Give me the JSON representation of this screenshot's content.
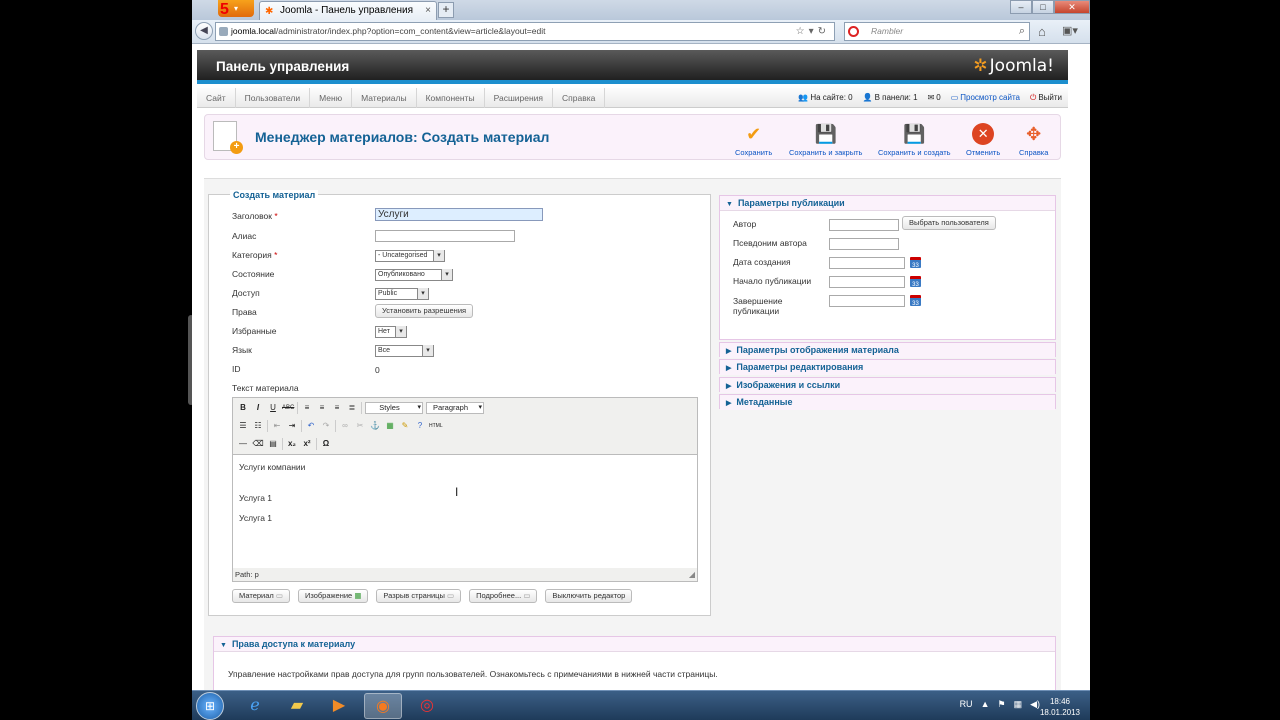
{
  "browser": {
    "tab_title": "Joomla - Панель управления",
    "url_host": "joomla.local",
    "url_path": "/administrator/index.php?option=com_content&view=article&layout=edit",
    "search_placeholder": "Rambler",
    "new_tab": "+",
    "tab_close": "×"
  },
  "header": {
    "title": "Панель управления",
    "logo_text": "Joomla!"
  },
  "menu": {
    "items": [
      "Сайт",
      "Пользователи",
      "Меню",
      "Материалы",
      "Компоненты",
      "Расширения",
      "Справка"
    ],
    "status_site": "На сайте: 0",
    "status_panel": "В панели: 1",
    "status_messages": "0",
    "view_site": "Просмотр сайта",
    "logout": "Выйти"
  },
  "toolbar": {
    "page_title": "Менеджер материалов: Создать материал",
    "save": "Сохранить",
    "save_close": "Сохранить и закрыть",
    "save_new": "Сохранить и создать",
    "cancel": "Отменить",
    "help": "Справка"
  },
  "form": {
    "legend": "Создать материал",
    "title_label": "Заголовок",
    "title_value": "Услуги",
    "alias_label": "Алиас",
    "alias_value": "",
    "category_label": "Категория",
    "category_value": "- Uncategorised",
    "state_label": "Состояние",
    "state_value": "Опубликовано",
    "access_label": "Доступ",
    "access_value": "Public",
    "permissions_label": "Права",
    "permissions_button": "Установить разрешения",
    "featured_label": "Избранные",
    "featured_value": "Нет",
    "language_label": "Язык",
    "language_value": "Все",
    "id_label": "ID",
    "id_value": "0",
    "text_label": "Текст материала",
    "required_mark": "*"
  },
  "editor": {
    "styles": "Styles",
    "format": "Paragraph",
    "lines": [
      "Услуги компании",
      "Услуга 1",
      "Услуга 1"
    ],
    "path": "Path: p"
  },
  "editor_buttons": [
    "Материал",
    "Изображение",
    "Разрыв страницы",
    "Подробнее...",
    "Выключить редактор"
  ],
  "publishing": {
    "header": "Параметры публикации",
    "author": "Автор",
    "select_user": "Выбрать пользователя",
    "alias": "Псевдоним автора",
    "created": "Дата создания",
    "publish_up": "Начало публикации",
    "publish_down_1": "Завершение",
    "publish_down_2": "публикации"
  },
  "sliders": [
    "Параметры отображения материала",
    "Параметры редактирования",
    "Изображения и ссылки",
    "Метаданные"
  ],
  "access_panel": {
    "header": "Права доступа к материалу",
    "text": "Управление настройками прав доступа для групп пользователей. Ознакомьтесь с примечаниями в нижней части страницы."
  },
  "taskbar": {
    "lang": "RU",
    "time": "18:46",
    "date": "18.01.2013"
  }
}
